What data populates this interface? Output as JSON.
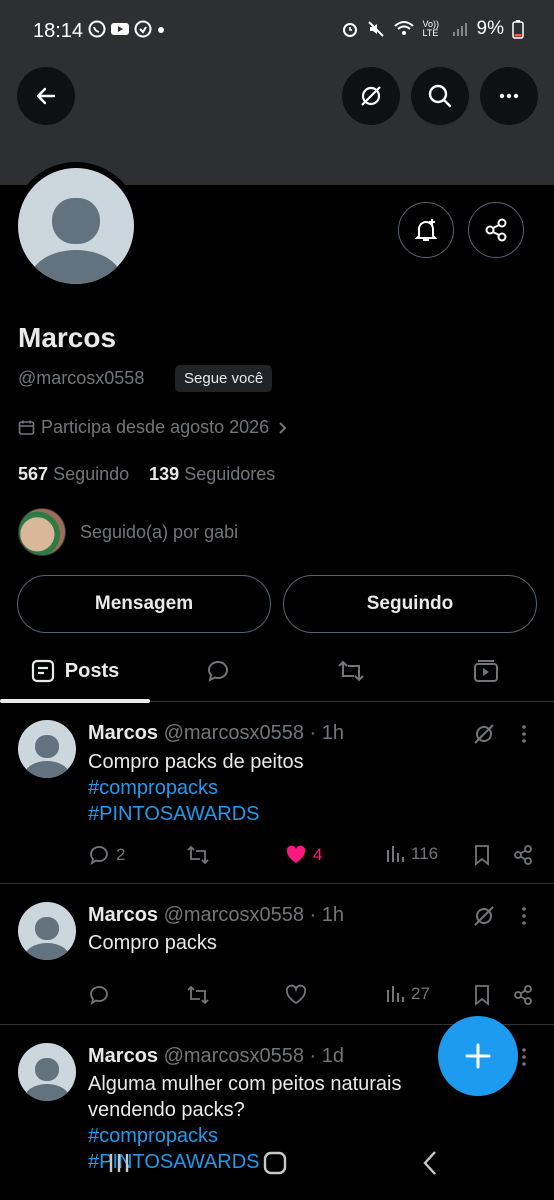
{
  "status_bar": {
    "time": "18:14",
    "battery": "9%",
    "volte": "Vo)) LTE"
  },
  "header": {
    "back_icon": "arrow-left-icon",
    "actions": [
      "grok-icon",
      "search-icon",
      "more-icon"
    ]
  },
  "profile": {
    "name": "Marcos",
    "handle": "@marcosx0558",
    "follows_you": "Segue você",
    "joined": "Participa desde agosto 2026",
    "following_count": "567",
    "following_label": "Seguindo",
    "followers_count": "139",
    "followers_label": "Seguidores",
    "followed_by": "Seguido(a) por gabi",
    "message_button": "Mensagem",
    "following_button": "Seguindo"
  },
  "tabs": [
    {
      "label": "Posts",
      "icon": "posts-icon",
      "active": true
    },
    {
      "label": "",
      "icon": "replies-icon"
    },
    {
      "label": "",
      "icon": "repost-icon"
    },
    {
      "label": "",
      "icon": "media-icon"
    }
  ],
  "posts": [
    {
      "author": "Marcos",
      "meta": "@marcosx0558 · 1h",
      "text": "Compro packs de peitos",
      "hashtags": [
        "#compropacks",
        "#PINTOSAWARDS"
      ],
      "replies": "2",
      "reposts": "",
      "likes": "4",
      "liked": true,
      "views": "116"
    },
    {
      "author": "Marcos",
      "meta": "@marcosx0558 · 1h",
      "text": "Compro packs",
      "hashtags": [],
      "replies": "",
      "reposts": "",
      "likes": "",
      "liked": false,
      "views": "27"
    },
    {
      "author": "Marcos",
      "meta": "@marcosx0558 · 1d",
      "text": "Alguma mulher com peitos naturais vendendo packs?",
      "hashtags": [
        "#compropacks",
        "#PINTOSAWARDS"
      ],
      "replies": "",
      "reposts": "",
      "likes": "",
      "liked": false,
      "views": ""
    }
  ],
  "colors": {
    "accent": "#1d9bf0",
    "like": "#f91880",
    "muted": "#71767b",
    "banner": "#2d2f33"
  }
}
